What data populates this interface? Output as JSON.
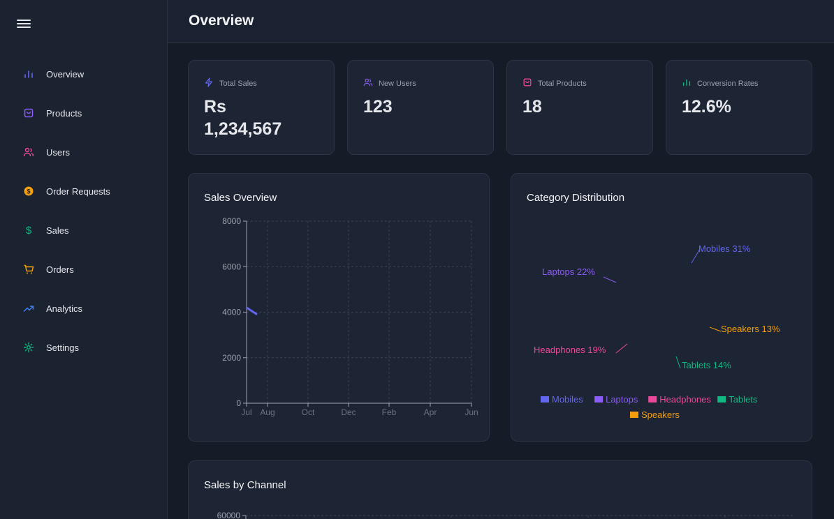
{
  "header": {
    "title": "Overview"
  },
  "sidebar": {
    "items": [
      {
        "label": "Overview",
        "icon": "bar-chart-icon",
        "color": "#6366f1"
      },
      {
        "label": "Products",
        "icon": "shopping-bag-icon",
        "color": "#8b5cf6"
      },
      {
        "label": "Users",
        "icon": "users-icon",
        "color": "#ec4899"
      },
      {
        "label": "Order Requests",
        "icon": "dollar-circle-icon",
        "color": "#f59e0b"
      },
      {
        "label": "Sales",
        "icon": "dollar-sign-icon",
        "color": "#10b981"
      },
      {
        "label": "Orders",
        "icon": "shopping-cart-icon",
        "color": "#f59e0b"
      },
      {
        "label": "Analytics",
        "icon": "trending-up-icon",
        "color": "#3b82f6"
      },
      {
        "label": "Settings",
        "icon": "settings-icon",
        "color": "#10b981"
      }
    ]
  },
  "stats": [
    {
      "label": "Total Sales",
      "value_line1": "Rs",
      "value_line2": "1,234,567",
      "icon": "zap-icon",
      "color": "#6366f1"
    },
    {
      "label": "New Users",
      "value": "123",
      "icon": "users-icon",
      "color": "#8b5cf6"
    },
    {
      "label": "Total Products",
      "value": "18",
      "icon": "shopping-bag-icon",
      "color": "#ec4899"
    },
    {
      "label": "Conversion Rates",
      "value": "12.6%",
      "icon": "bar-chart-icon",
      "color": "#10b981"
    }
  ],
  "panels": {
    "sales_overview": {
      "title": "Sales Overview"
    },
    "category_distribution": {
      "title": "Category Distribution"
    },
    "sales_by_channel": {
      "title": "Sales by Channel"
    }
  },
  "chart_data": [
    {
      "type": "line",
      "title": "Sales Overview",
      "categories": [
        "Jul",
        "Aug",
        "Oct",
        "Dec",
        "Feb",
        "Apr",
        "Jun"
      ],
      "ylim": [
        0,
        8000
      ],
      "yticks": [
        0,
        2000,
        4000,
        6000,
        8000
      ],
      "series": [
        {
          "color": "#6366f1",
          "values": [
            4200,
            3900
          ]
        }
      ],
      "grid": true
    },
    {
      "type": "pie",
      "title": "Category Distribution",
      "slices": [
        {
          "name": "Mobiles",
          "percent": 31,
          "label": "Mobiles 31%",
          "color": "#6366f1"
        },
        {
          "name": "Laptops",
          "percent": 22,
          "label": "Laptops 22%",
          "color": "#8b5cf6"
        },
        {
          "name": "Headphones",
          "percent": 19,
          "label": "Headphones 19%",
          "color": "#ec4899"
        },
        {
          "name": "Tablets",
          "percent": 14,
          "label": "Tablets 14%",
          "color": "#10b981"
        },
        {
          "name": "Speakers",
          "percent": 13,
          "label": "Speakers 13%",
          "color": "#f59e0b"
        }
      ],
      "legend": "bottom"
    },
    {
      "type": "bar",
      "title": "Sales by Channel",
      "yticks": [
        60000
      ],
      "grid": true
    }
  ]
}
